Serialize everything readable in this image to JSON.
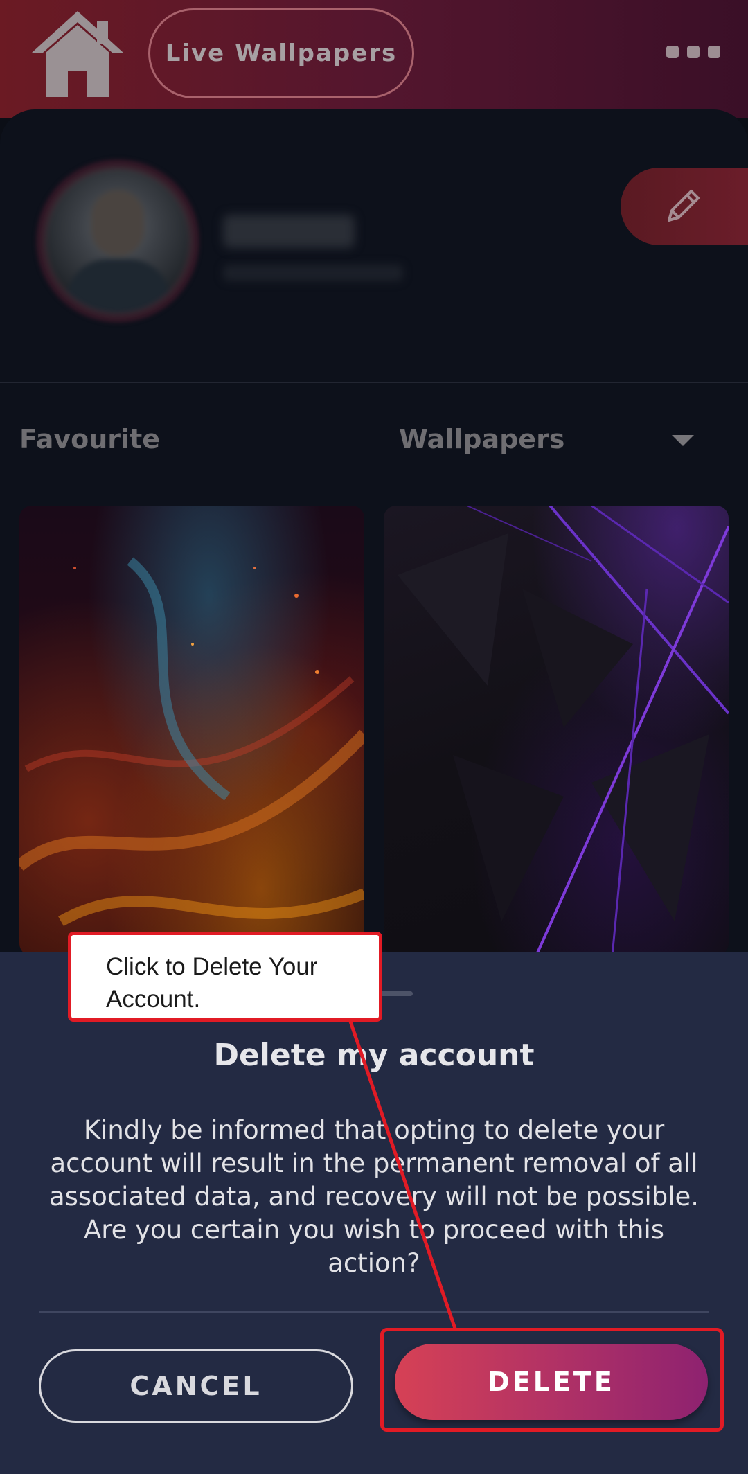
{
  "header": {
    "live_wallpapers_label": "Live Wallpapers"
  },
  "tabs": {
    "favourite": "Favourite",
    "wallpapers": "Wallpapers"
  },
  "dialog": {
    "title": "Delete my account",
    "body": "Kindly be informed that opting to delete your account will result in the permanent removal of all associated data, and recovery will not be possible. Are you certain you wish to proceed with this action?",
    "cancel_label": "CANCEL",
    "delete_label": "DELETE"
  },
  "annotation": {
    "callout_text": "Click to Delete Your Account.",
    "color": "#e11b25"
  },
  "colors": {
    "accent": "#d64155",
    "sheet_bg": "#232a43"
  }
}
